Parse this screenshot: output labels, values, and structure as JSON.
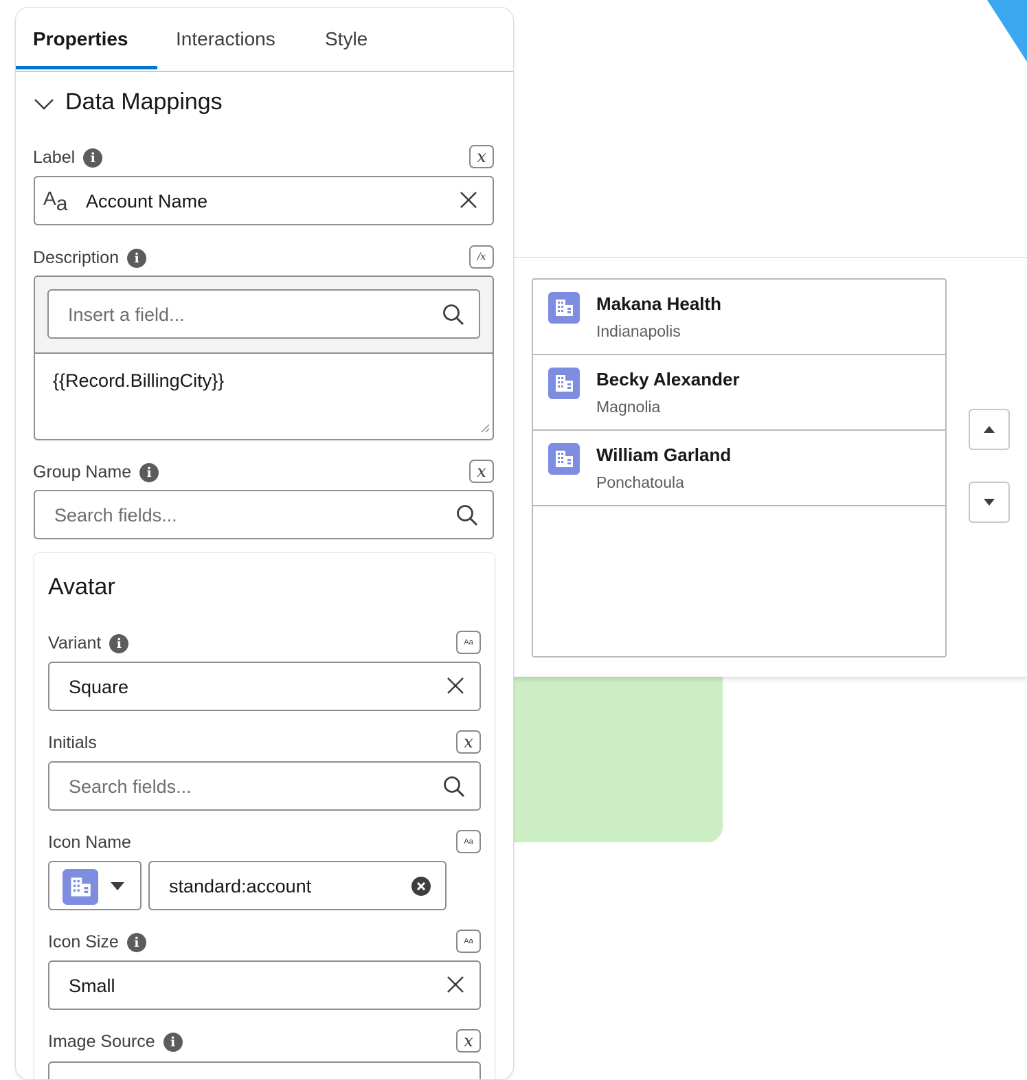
{
  "tabs": [
    {
      "label": "Properties",
      "active": true
    },
    {
      "label": "Interactions",
      "active": false
    },
    {
      "label": "Style",
      "active": false
    }
  ],
  "section": {
    "title": "Data Mappings"
  },
  "fields": {
    "label": {
      "label": "Label",
      "value": "Account Name"
    },
    "description": {
      "label": "Description",
      "insert_placeholder": "Insert a field...",
      "value": "{{Record.BillingCity}}"
    },
    "group_name": {
      "label": "Group Name",
      "placeholder": "Search fields..."
    }
  },
  "avatar": {
    "title": "Avatar",
    "variant": {
      "label": "Variant",
      "value": "Square"
    },
    "initials": {
      "label": "Initials",
      "placeholder": "Search fields..."
    },
    "icon_name": {
      "label": "Icon Name",
      "value": "standard:account"
    },
    "icon_size": {
      "label": "Icon Size",
      "value": "Small"
    },
    "image_source": {
      "label": "Image Source"
    }
  },
  "preview": {
    "items": [
      {
        "title": "Makana Health",
        "subtitle": "Indianapolis",
        "icon": "account-icon"
      },
      {
        "title": "Becky Alexander",
        "subtitle": "Magnolia",
        "icon": "account-icon"
      },
      {
        "title": "William Garland",
        "subtitle": "Ponchatoula",
        "icon": "account-icon"
      }
    ]
  },
  "colors": {
    "accent": "#0176d3",
    "account_icon": "#7f8de1",
    "green_region": "#cdeec4",
    "corner_triangle": "#3ba7f0"
  },
  "mode_buttons": {
    "x": "x",
    "fx": "/x",
    "aa": "Aa"
  }
}
